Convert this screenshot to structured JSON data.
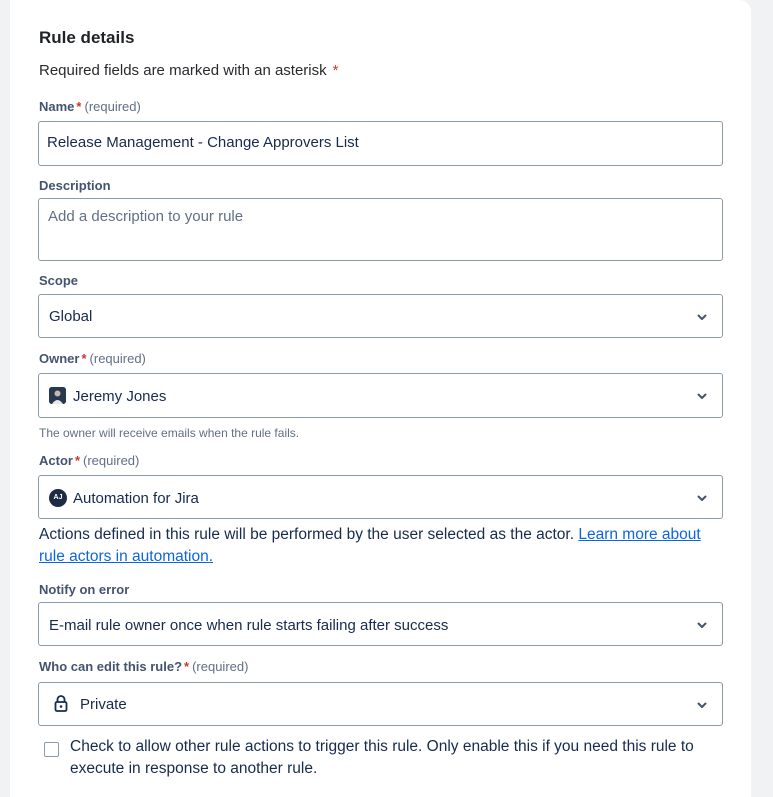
{
  "section": {
    "title": "Rule details",
    "required_note": "Required fields are marked with an asterisk",
    "asterisk": "*"
  },
  "name_field": {
    "label": "Name",
    "star": "*",
    "required": "(required)",
    "value": "Release Management - Change Approvers List"
  },
  "description_field": {
    "label": "Description",
    "placeholder": "Add a description to your rule"
  },
  "scope_field": {
    "label": "Scope",
    "value": "Global"
  },
  "owner_field": {
    "label": "Owner",
    "star": "*",
    "required": "(required)",
    "value": "Jeremy Jones",
    "helper": "The owner will receive emails when the rule fails."
  },
  "actor_field": {
    "label": "Actor",
    "star": "*",
    "required": "(required)",
    "avatar_initials": "AJ",
    "value": "Automation for Jira",
    "description": "Actions defined in this rule will be performed by the user selected as the actor. ",
    "link_text": "Learn more about rule actors in automation."
  },
  "notify_field": {
    "label": "Notify on error",
    "value": "E-mail rule owner once when rule starts failing after success"
  },
  "edit_field": {
    "label": "Who can edit this rule?",
    "star": "*",
    "required": "(required)",
    "value": "Private",
    "icon": "lock-icon"
  },
  "trigger_checkbox": {
    "checked": false,
    "label": "Check to allow other rule actions to trigger this rule. Only enable this if you need this rule to execute in response to another rule."
  },
  "colors": {
    "link": "#0c66e4",
    "required_star": "#c9372c",
    "border": "#8c9bab"
  }
}
